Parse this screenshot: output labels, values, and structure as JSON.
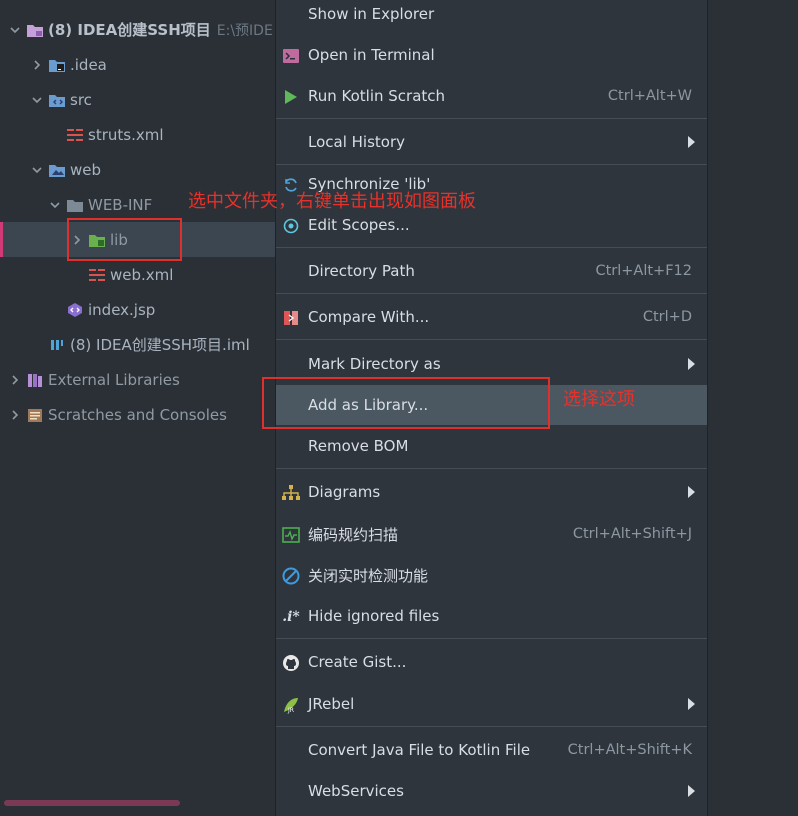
{
  "tree": {
    "items": [
      {
        "label": "(8) IDEA创建SSH项目",
        "suffix": "E:\\预IDE"
      },
      {
        "label": ".idea"
      },
      {
        "label": "src"
      },
      {
        "label": "struts.xml"
      },
      {
        "label": "web"
      },
      {
        "label": "WEB-INF"
      },
      {
        "label": "lib"
      },
      {
        "label": "web.xml"
      },
      {
        "label": "index.jsp"
      },
      {
        "label": "(8) IDEA创建SSH项目.iml"
      },
      {
        "label": "External Libraries"
      },
      {
        "label": "Scratches and Consoles"
      }
    ]
  },
  "menu": {
    "items": [
      {
        "label": "Show in Explorer"
      },
      {
        "label": "Open in Terminal"
      },
      {
        "label": "Run Kotlin Scratch",
        "shortcut": "Ctrl+Alt+W"
      },
      {
        "label": "Local History"
      },
      {
        "label": "Synchronize 'lib'"
      },
      {
        "label": "Edit Scopes..."
      },
      {
        "label": "Directory Path",
        "shortcut": "Ctrl+Alt+F12"
      },
      {
        "label": "Compare With...",
        "shortcut": "Ctrl+D"
      },
      {
        "label": "Mark Directory as"
      },
      {
        "label": "Add as Library..."
      },
      {
        "label": "Remove BOM"
      },
      {
        "label": "Diagrams"
      },
      {
        "label": "编码规约扫描",
        "shortcut": "Ctrl+Alt+Shift+J"
      },
      {
        "label": "关闭实时检测功能"
      },
      {
        "label": "Hide ignored files"
      },
      {
        "label": "Create Gist..."
      },
      {
        "label": "JRebel"
      },
      {
        "label": "Convert Java File to Kotlin File",
        "shortcut": "Ctrl+Alt+Shift+K"
      },
      {
        "label": "WebServices"
      }
    ]
  },
  "annotations": {
    "note1": "选中文件夹，右键单击出现如图面板",
    "note2": "选择这项"
  },
  "colors": {
    "annotation": "#e0302d",
    "highlight": "#4b5862",
    "selected_row": "#3c4650",
    "menu_bg": "#2f353c",
    "tree_bg": "#2b3036"
  }
}
